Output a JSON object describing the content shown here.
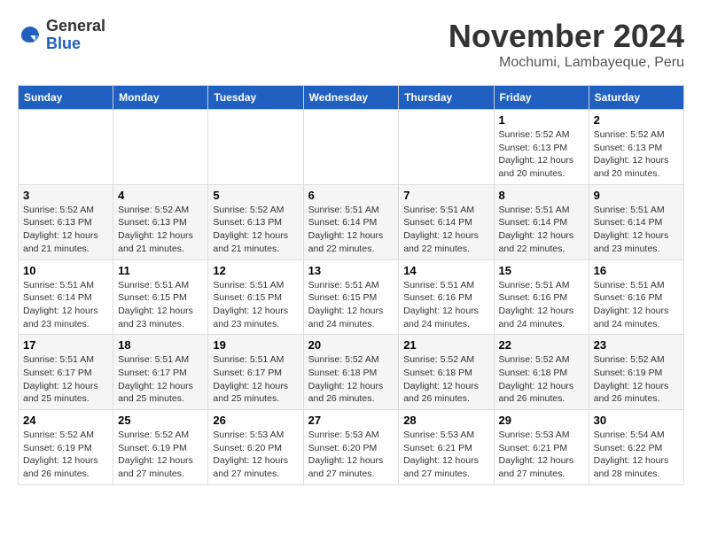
{
  "logo": {
    "general": "General",
    "blue": "Blue"
  },
  "header": {
    "title": "November 2024",
    "location": "Mochumi, Lambayeque, Peru"
  },
  "weekdays": [
    "Sunday",
    "Monday",
    "Tuesday",
    "Wednesday",
    "Thursday",
    "Friday",
    "Saturday"
  ],
  "weeks": [
    [
      {
        "day": "",
        "info": ""
      },
      {
        "day": "",
        "info": ""
      },
      {
        "day": "",
        "info": ""
      },
      {
        "day": "",
        "info": ""
      },
      {
        "day": "",
        "info": ""
      },
      {
        "day": "1",
        "info": "Sunrise: 5:52 AM\nSunset: 6:13 PM\nDaylight: 12 hours\nand 20 minutes."
      },
      {
        "day": "2",
        "info": "Sunrise: 5:52 AM\nSunset: 6:13 PM\nDaylight: 12 hours\nand 20 minutes."
      }
    ],
    [
      {
        "day": "3",
        "info": "Sunrise: 5:52 AM\nSunset: 6:13 PM\nDaylight: 12 hours\nand 21 minutes."
      },
      {
        "day": "4",
        "info": "Sunrise: 5:52 AM\nSunset: 6:13 PM\nDaylight: 12 hours\nand 21 minutes."
      },
      {
        "day": "5",
        "info": "Sunrise: 5:52 AM\nSunset: 6:13 PM\nDaylight: 12 hours\nand 21 minutes."
      },
      {
        "day": "6",
        "info": "Sunrise: 5:51 AM\nSunset: 6:14 PM\nDaylight: 12 hours\nand 22 minutes."
      },
      {
        "day": "7",
        "info": "Sunrise: 5:51 AM\nSunset: 6:14 PM\nDaylight: 12 hours\nand 22 minutes."
      },
      {
        "day": "8",
        "info": "Sunrise: 5:51 AM\nSunset: 6:14 PM\nDaylight: 12 hours\nand 22 minutes."
      },
      {
        "day": "9",
        "info": "Sunrise: 5:51 AM\nSunset: 6:14 PM\nDaylight: 12 hours\nand 23 minutes."
      }
    ],
    [
      {
        "day": "10",
        "info": "Sunrise: 5:51 AM\nSunset: 6:14 PM\nDaylight: 12 hours\nand 23 minutes."
      },
      {
        "day": "11",
        "info": "Sunrise: 5:51 AM\nSunset: 6:15 PM\nDaylight: 12 hours\nand 23 minutes."
      },
      {
        "day": "12",
        "info": "Sunrise: 5:51 AM\nSunset: 6:15 PM\nDaylight: 12 hours\nand 23 minutes."
      },
      {
        "day": "13",
        "info": "Sunrise: 5:51 AM\nSunset: 6:15 PM\nDaylight: 12 hours\nand 24 minutes."
      },
      {
        "day": "14",
        "info": "Sunrise: 5:51 AM\nSunset: 6:16 PM\nDaylight: 12 hours\nand 24 minutes."
      },
      {
        "day": "15",
        "info": "Sunrise: 5:51 AM\nSunset: 6:16 PM\nDaylight: 12 hours\nand 24 minutes."
      },
      {
        "day": "16",
        "info": "Sunrise: 5:51 AM\nSunset: 6:16 PM\nDaylight: 12 hours\nand 24 minutes."
      }
    ],
    [
      {
        "day": "17",
        "info": "Sunrise: 5:51 AM\nSunset: 6:17 PM\nDaylight: 12 hours\nand 25 minutes."
      },
      {
        "day": "18",
        "info": "Sunrise: 5:51 AM\nSunset: 6:17 PM\nDaylight: 12 hours\nand 25 minutes."
      },
      {
        "day": "19",
        "info": "Sunrise: 5:51 AM\nSunset: 6:17 PM\nDaylight: 12 hours\nand 25 minutes."
      },
      {
        "day": "20",
        "info": "Sunrise: 5:52 AM\nSunset: 6:18 PM\nDaylight: 12 hours\nand 26 minutes."
      },
      {
        "day": "21",
        "info": "Sunrise: 5:52 AM\nSunset: 6:18 PM\nDaylight: 12 hours\nand 26 minutes."
      },
      {
        "day": "22",
        "info": "Sunrise: 5:52 AM\nSunset: 6:18 PM\nDaylight: 12 hours\nand 26 minutes."
      },
      {
        "day": "23",
        "info": "Sunrise: 5:52 AM\nSunset: 6:19 PM\nDaylight: 12 hours\nand 26 minutes."
      }
    ],
    [
      {
        "day": "24",
        "info": "Sunrise: 5:52 AM\nSunset: 6:19 PM\nDaylight: 12 hours\nand 26 minutes."
      },
      {
        "day": "25",
        "info": "Sunrise: 5:52 AM\nSunset: 6:19 PM\nDaylight: 12 hours\nand 27 minutes."
      },
      {
        "day": "26",
        "info": "Sunrise: 5:53 AM\nSunset: 6:20 PM\nDaylight: 12 hours\nand 27 minutes."
      },
      {
        "day": "27",
        "info": "Sunrise: 5:53 AM\nSunset: 6:20 PM\nDaylight: 12 hours\nand 27 minutes."
      },
      {
        "day": "28",
        "info": "Sunrise: 5:53 AM\nSunset: 6:21 PM\nDaylight: 12 hours\nand 27 minutes."
      },
      {
        "day": "29",
        "info": "Sunrise: 5:53 AM\nSunset: 6:21 PM\nDaylight: 12 hours\nand 27 minutes."
      },
      {
        "day": "30",
        "info": "Sunrise: 5:54 AM\nSunset: 6:22 PM\nDaylight: 12 hours\nand 28 minutes."
      }
    ]
  ]
}
